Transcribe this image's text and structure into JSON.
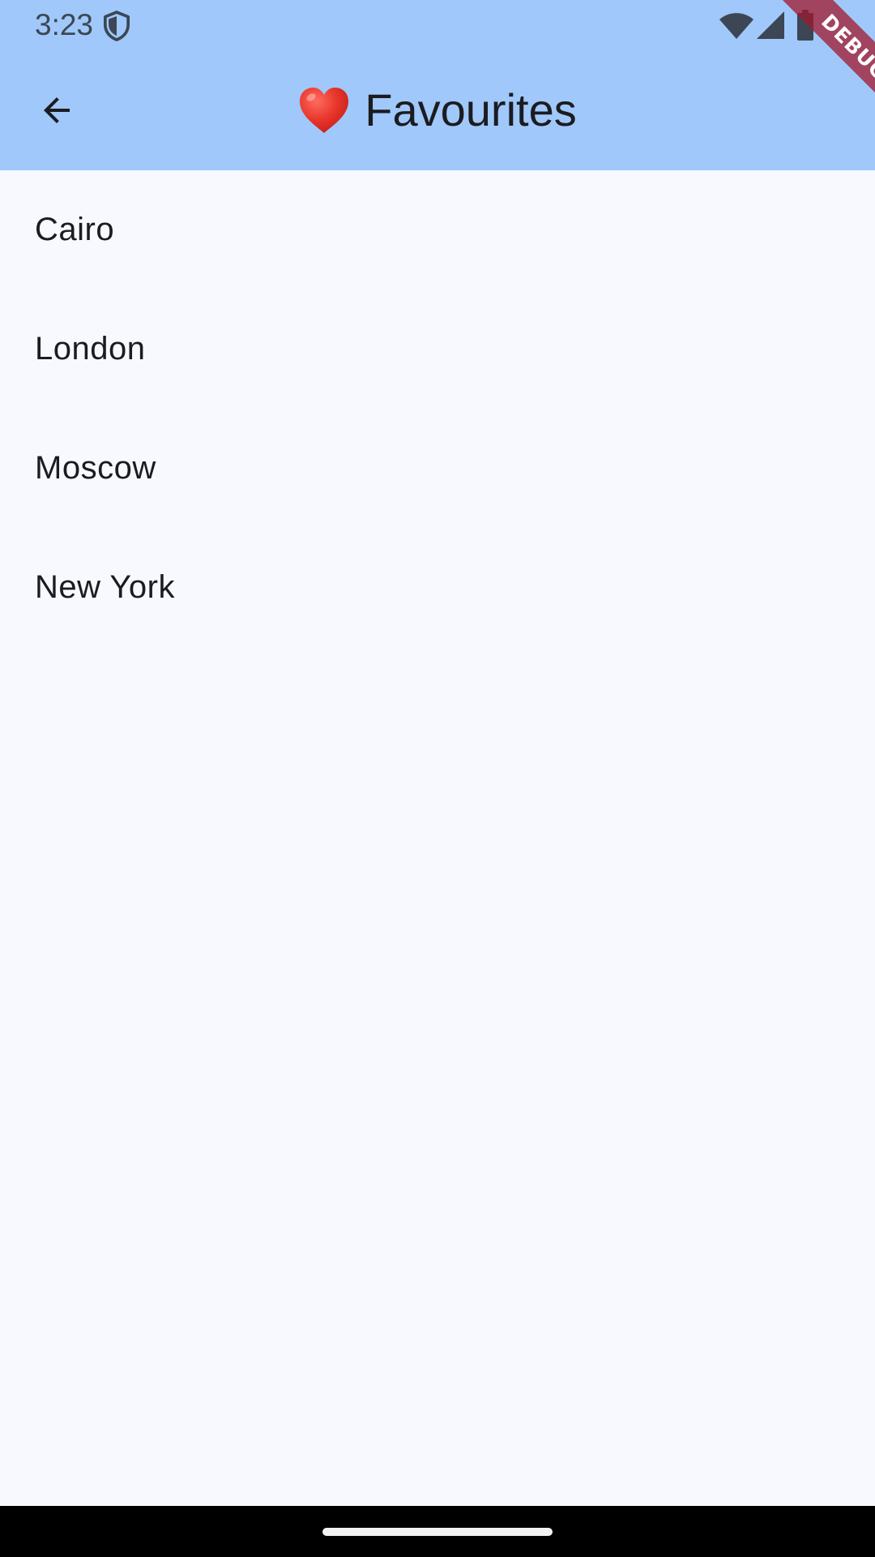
{
  "status_bar": {
    "time": "3:23",
    "icons": [
      "shield-icon",
      "wifi-icon",
      "signal-icon",
      "battery-icon"
    ]
  },
  "app_bar": {
    "back_icon": "arrow-back-icon",
    "title_emoji_icon": "red-heart-icon",
    "title": "Favourites",
    "background": "#a0c8fa"
  },
  "debug_banner": {
    "label": "DEBUG"
  },
  "favourites": [
    {
      "label": "Cairo"
    },
    {
      "label": "London"
    },
    {
      "label": "Moscow"
    },
    {
      "label": "New York"
    }
  ],
  "colors": {
    "page_background": "#f7f9ff",
    "text": "#1b1c20",
    "heart": "#e0312b",
    "debug_ribbon": "#a0182c"
  }
}
